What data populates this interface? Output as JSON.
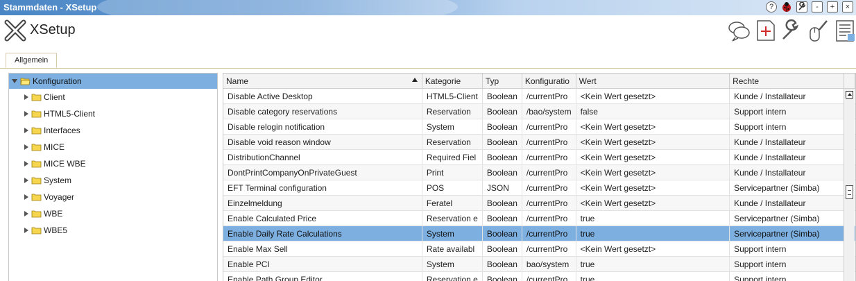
{
  "window": {
    "title": "Stammdaten - XSetup",
    "buttons": [
      {
        "name": "help-button",
        "label": "?"
      },
      {
        "name": "bug-button",
        "label": ""
      },
      {
        "name": "tools-button",
        "label": ""
      },
      {
        "name": "minimize-button",
        "label": "-"
      },
      {
        "name": "maximize-button",
        "label": "+"
      },
      {
        "name": "close-button",
        "label": "×"
      }
    ]
  },
  "app": {
    "title": "XSetup"
  },
  "toolbar": {
    "icons": [
      "chat-icon",
      "new-document-icon",
      "wrench-icon",
      "mouse-brush-icon",
      "document-list-icon"
    ]
  },
  "tabs": [
    {
      "label": "Allgemein"
    }
  ],
  "tree": {
    "root": "Konfiguration",
    "items": [
      "Client",
      "HTML5-Client",
      "Interfaces",
      "MICE",
      "MICE WBE",
      "System",
      "Voyager",
      "WBE",
      "WBE5"
    ]
  },
  "grid": {
    "columns": [
      "Name",
      "Kategorie",
      "Typ",
      "Konfiguratio",
      "Wert",
      "Rechte"
    ],
    "rows": [
      [
        "Disable Active Desktop",
        "HTML5-Client",
        "Boolean",
        "/currentPro",
        "<Kein Wert gesetzt>",
        "Kunde / Installateur"
      ],
      [
        "Disable category reservations",
        "Reservation",
        "Boolean",
        "/bao/system",
        "false",
        "Support intern"
      ],
      [
        "Disable relogin notification",
        "System",
        "Boolean",
        "/currentPro",
        "<Kein Wert gesetzt>",
        "Support intern"
      ],
      [
        "Disable void reason window",
        "Reservation",
        "Boolean",
        "/currentPro",
        "<Kein Wert gesetzt>",
        "Kunde / Installateur"
      ],
      [
        "DistributionChannel",
        "Required Fiel",
        "Boolean",
        "/currentPro",
        "<Kein Wert gesetzt>",
        "Kunde / Installateur"
      ],
      [
        "DontPrintCompanyOnPrivateGuest",
        "Print",
        "Boolean",
        "/currentPro",
        "<Kein Wert gesetzt>",
        "Kunde / Installateur"
      ],
      [
        "EFT Terminal configuration",
        "POS",
        "JSON",
        "/currentPro",
        "<Kein Wert gesetzt>",
        "Servicepartner (Simba)"
      ],
      [
        "Einzelmeldung",
        "Feratel",
        "Boolean",
        "/currentPro",
        "<Kein Wert gesetzt>",
        "Kunde / Installateur"
      ],
      [
        "Enable Calculated Price",
        "Reservation e",
        "Boolean",
        "/currentPro",
        "true",
        "Servicepartner (Simba)"
      ],
      [
        "Enable Daily Rate Calculations",
        "System",
        "Boolean",
        "/currentPro",
        "true",
        "Servicepartner (Simba)"
      ],
      [
        "Enable Max Sell",
        "Rate availabl",
        "Boolean",
        "/currentPro",
        "<Kein Wert gesetzt>",
        "Support intern"
      ],
      [
        "Enable PCI",
        "System",
        "Boolean",
        "bao/system",
        "true",
        "Support intern"
      ],
      [
        "Enable Path Group Editor",
        "Reservation e",
        "Boolean",
        "/currentPro",
        "true",
        "Support intern"
      ]
    ],
    "selected_row": 9,
    "sort_column": "Name",
    "sort_direction": "ascending"
  },
  "colors": {
    "selection": "#7db0e0",
    "titlebar": "#4a86c5",
    "folder": "#f5d64e"
  }
}
